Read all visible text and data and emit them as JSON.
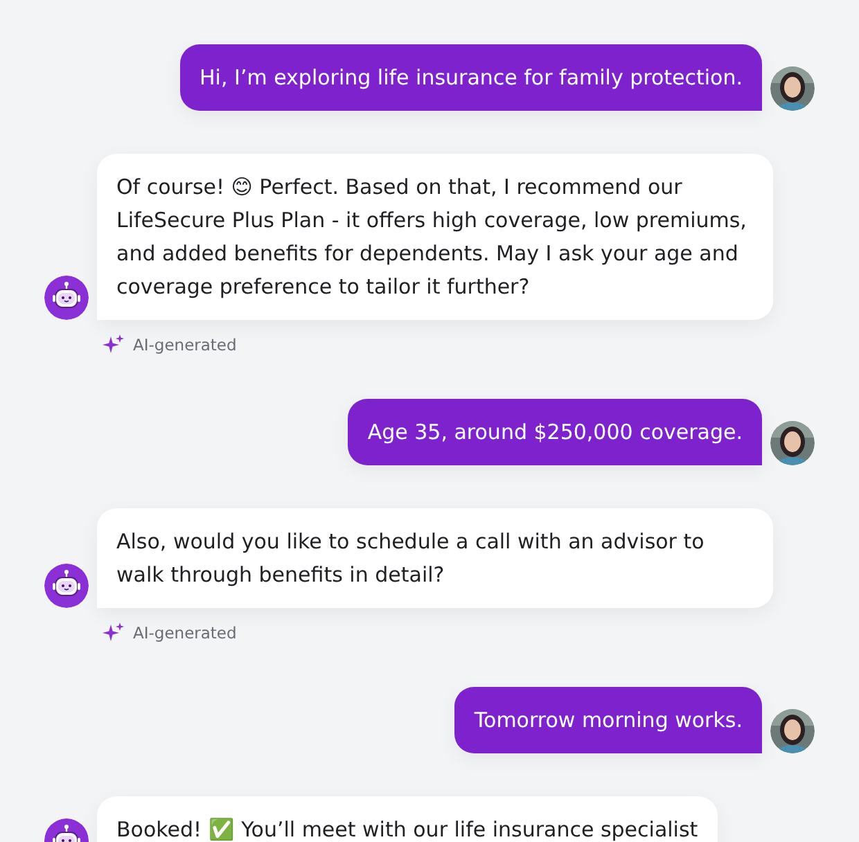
{
  "messages": [
    {
      "kind": "user",
      "text": "Hi, I’m exploring life insurance for family protection."
    },
    {
      "kind": "bot",
      "text": "Of course! 😊 Perfect. Based on that, I recommend our LifeSecure Plus Plan - it offers high coverage, low premiums, and added benefits for dependents. May I ask your age and coverage preference to tailor it further?",
      "label": "AI-generated"
    },
    {
      "kind": "user",
      "text": "Age 35, around $250,000 coverage."
    },
    {
      "kind": "bot",
      "text": "Also, would you like to schedule a call with an advisor to walk through benefits in detail?",
      "label": "AI-generated"
    },
    {
      "kind": "user",
      "text": "Tomorrow morning works."
    },
    {
      "kind": "bot",
      "text": "Booked! ✅ You’ll meet with our life insurance specialist"
    }
  ]
}
